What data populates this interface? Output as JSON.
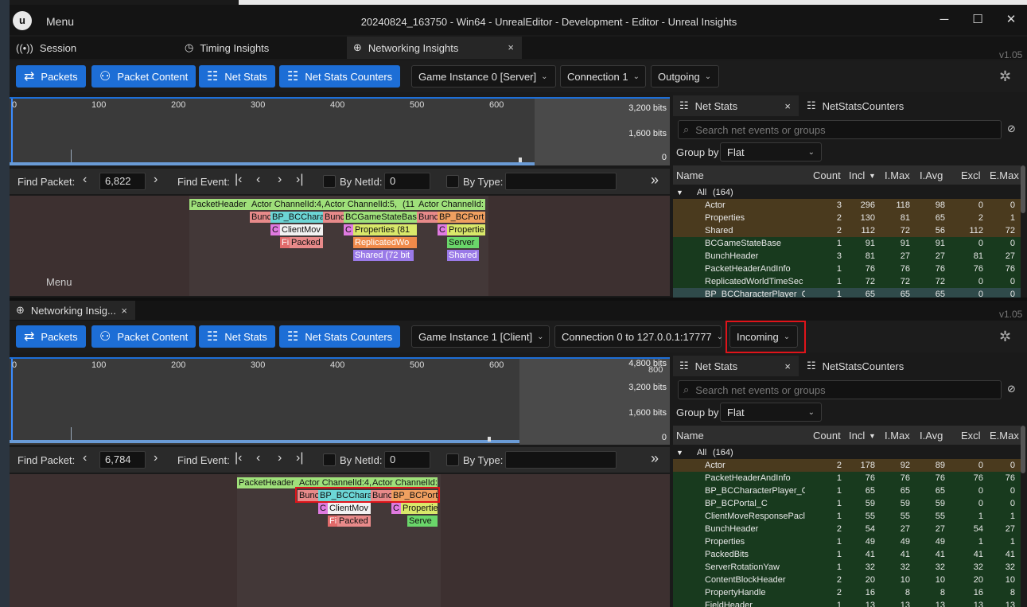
{
  "app": {
    "menu_label": "Menu",
    "window_title": "20240824_163750 - Win64 - UnrealEditor - Development - Editor - Unreal Insights",
    "minimize_glyph": "─",
    "maximize_glyph": "☐",
    "close_glyph": "✕",
    "logo_glyph": "u"
  },
  "tabs": {
    "session": "Session",
    "timing": "Timing Insights",
    "networking": "Networking Insights",
    "close_glyph": "×",
    "version": "v1.05"
  },
  "toolbar": {
    "packets": "Packets",
    "packet_content": "Packet Content",
    "net_stats": "Net Stats",
    "net_stats_counters": "Net Stats Counters"
  },
  "panel1": {
    "game_instance": "Game Instance 0 [Server]",
    "connection": "Connection 1",
    "direction": "Outgoing",
    "ruler": [
      "0",
      "100",
      "200",
      "300",
      "400",
      "500",
      "600"
    ],
    "bits": [
      "3,200 bits",
      "1,600 bits",
      "0"
    ],
    "find_packet_label": "Find Packet:",
    "find_packet_value": "6,822",
    "find_event_label": "Find Event:",
    "by_netid_label": "By NetId:",
    "netid_value": "0",
    "by_type_label": "By Type:",
    "menu_overlay": "Menu",
    "events": {
      "r1": [
        "PacketHeader",
        "Actor ChannelId:4,",
        "Actor ChannelId:5,",
        "(11",
        "Actor ChannelId:"
      ],
      "r2": [
        "Bunc",
        "BP_BCChara",
        "Bunc",
        "BCGameStateBas",
        "Bunc",
        "BP_BCPort"
      ],
      "r3": [
        "C",
        "ClientMov",
        "C",
        "Properties (81",
        "C",
        "Propertie"
      ],
      "r4": [
        "Fi",
        "Packed",
        "ReplicatedWo",
        "Server"
      ],
      "r5": [
        "Shared (72 bit",
        "Shared"
      ]
    }
  },
  "panel2": {
    "tab_title": "Networking Insig...",
    "game_instance": "Game Instance 1 [Client]",
    "connection": "Connection 0 to 127.0.0.1:17777",
    "direction": "Incoming",
    "ruler": [
      "0",
      "100",
      "200",
      "300",
      "400",
      "500",
      "600",
      "800"
    ],
    "bits": [
      "4,800 bits",
      "3,200 bits",
      "1,600 bits",
      "0"
    ],
    "find_packet_label": "Find Packet:",
    "find_packet_value": "6,784",
    "find_event_label": "Find Event:",
    "by_netid_label": "By NetId:",
    "netid_value": "0",
    "by_type_label": "By Type:",
    "events": {
      "r1": [
        "PacketHeader",
        "Actor ChannelId:4,",
        "Actor ChannelId:"
      ],
      "r2": [
        "Bunc",
        "BP_BCChara",
        "Bunc",
        "BP_BCPort"
      ],
      "r3": [
        "C",
        "ClientMov",
        "C",
        "Propertie"
      ],
      "r4": [
        "Fi",
        "Packed",
        "Serve"
      ]
    }
  },
  "sidepanel": {
    "tab_net_stats": "Net Stats",
    "tab_counters": "NetStatsCounters",
    "close_glyph": "×",
    "search_placeholder": "Search net events or groups",
    "group_by_label": "Group by",
    "group_by_value": "Flat",
    "columns": {
      "name": "Name",
      "count": "Count",
      "incl": "Incl",
      "imax": "I.Max",
      "iavg": "I.Avg",
      "excl": "Excl",
      "emax": "E.Max"
    }
  },
  "stats1": {
    "all_label": "All",
    "all_count": "(164)",
    "rows": [
      {
        "name": "Actor",
        "count": "3",
        "incl": "296",
        "imax": "118",
        "iavg": "98",
        "excl": "0",
        "emax": "0",
        "bg": "#4a3a1e"
      },
      {
        "name": "Properties",
        "count": "2",
        "incl": "130",
        "imax": "81",
        "iavg": "65",
        "excl": "2",
        "emax": "1",
        "bg": "#4a3a1e"
      },
      {
        "name": "Shared",
        "count": "2",
        "incl": "112",
        "imax": "72",
        "iavg": "56",
        "excl": "112",
        "emax": "72",
        "bg": "#4a3a1e"
      },
      {
        "name": "BCGameStateBase",
        "count": "1",
        "incl": "91",
        "imax": "91",
        "iavg": "91",
        "excl": "0",
        "emax": "0",
        "bg": "#183a1e"
      },
      {
        "name": "BunchHeader",
        "count": "3",
        "incl": "81",
        "imax": "27",
        "iavg": "27",
        "excl": "81",
        "emax": "27",
        "bg": "#183a1e"
      },
      {
        "name": "PacketHeaderAndInfo",
        "count": "1",
        "incl": "76",
        "imax": "76",
        "iavg": "76",
        "excl": "76",
        "emax": "76",
        "bg": "#183a1e"
      },
      {
        "name": "ReplicatedWorldTimeSec",
        "count": "1",
        "incl": "72",
        "imax": "72",
        "iavg": "72",
        "excl": "0",
        "emax": "0",
        "bg": "#183a1e"
      },
      {
        "name": "BP_BCCharacterPlayer_C",
        "count": "1",
        "incl": "65",
        "imax": "65",
        "iavg": "65",
        "excl": "0",
        "emax": "0",
        "bg": "#2f4a4a"
      }
    ]
  },
  "stats2": {
    "all_label": "All",
    "all_count": "(164)",
    "rows": [
      {
        "name": "Actor",
        "count": "2",
        "incl": "178",
        "imax": "92",
        "iavg": "89",
        "excl": "0",
        "emax": "0",
        "bg": "#4a3a1e"
      },
      {
        "name": "PacketHeaderAndInfo",
        "count": "1",
        "incl": "76",
        "imax": "76",
        "iavg": "76",
        "excl": "76",
        "emax": "76",
        "bg": "#183a1e"
      },
      {
        "name": "BP_BCCharacterPlayer_C",
        "count": "1",
        "incl": "65",
        "imax": "65",
        "iavg": "65",
        "excl": "0",
        "emax": "0",
        "bg": "#183a1e"
      },
      {
        "name": "BP_BCPortal_C",
        "count": "1",
        "incl": "59",
        "imax": "59",
        "iavg": "59",
        "excl": "0",
        "emax": "0",
        "bg": "#183a1e"
      },
      {
        "name": "ClientMoveResponsePacl",
        "count": "1",
        "incl": "55",
        "imax": "55",
        "iavg": "55",
        "excl": "1",
        "emax": "1",
        "bg": "#183a1e"
      },
      {
        "name": "BunchHeader",
        "count": "2",
        "incl": "54",
        "imax": "27",
        "iavg": "27",
        "excl": "54",
        "emax": "27",
        "bg": "#183a1e"
      },
      {
        "name": "Properties",
        "count": "1",
        "incl": "49",
        "imax": "49",
        "iavg": "49",
        "excl": "1",
        "emax": "1",
        "bg": "#183a1e"
      },
      {
        "name": "PackedBits",
        "count": "1",
        "incl": "41",
        "imax": "41",
        "iavg": "41",
        "excl": "41",
        "emax": "41",
        "bg": "#183a1e"
      },
      {
        "name": "ServerRotationYaw",
        "count": "1",
        "incl": "32",
        "imax": "32",
        "iavg": "32",
        "excl": "32",
        "emax": "32",
        "bg": "#183a1e"
      },
      {
        "name": "ContentBlockHeader",
        "count": "2",
        "incl": "20",
        "imax": "10",
        "iavg": "10",
        "excl": "20",
        "emax": "10",
        "bg": "#183a1e"
      },
      {
        "name": "PropertyHandle",
        "count": "2",
        "incl": "16",
        "imax": "8",
        "iavg": "8",
        "excl": "16",
        "emax": "8",
        "bg": "#183a1e"
      },
      {
        "name": "FieldHeader",
        "count": "1",
        "incl": "13",
        "imax": "13",
        "iavg": "13",
        "excl": "13",
        "emax": "13",
        "bg": "#183a1e"
      }
    ]
  },
  "colors": {
    "accent": "#1d6ed6",
    "highlight": "#e0141a"
  }
}
